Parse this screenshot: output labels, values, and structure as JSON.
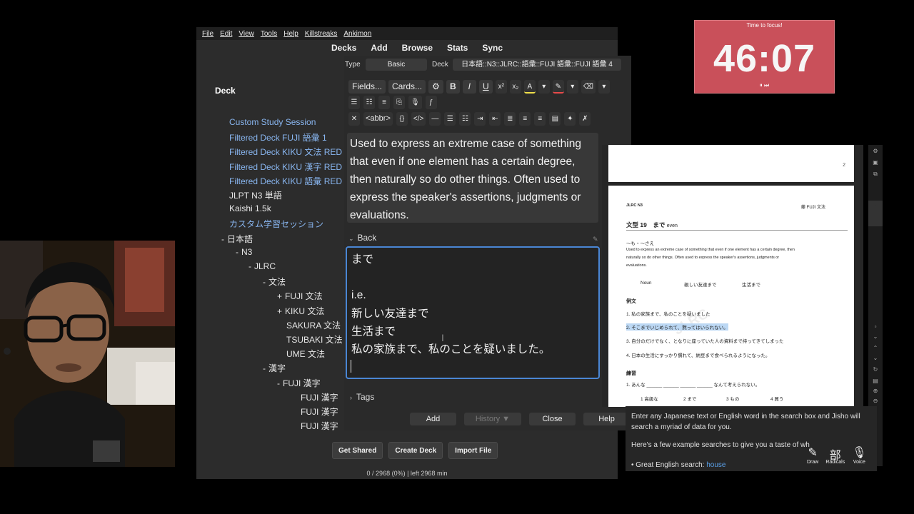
{
  "menubar": {
    "items": [
      "File",
      "Edit",
      "View",
      "Tools",
      "Help",
      "Killstreaks",
      "Ankimon"
    ]
  },
  "toolbar": {
    "items": [
      "Decks",
      "Add",
      "Browse",
      "Stats",
      "Sync"
    ]
  },
  "deck_header": "Deck",
  "decks": [
    {
      "label": "Custom Study Session",
      "style": "blue",
      "prefix": "",
      "indent": 0
    },
    {
      "label": "Filtered Deck FUJI 語彙 1",
      "style": "blue",
      "prefix": "",
      "indent": 0
    },
    {
      "label": "Filtered Deck KIKU 文法 RED",
      "style": "blue",
      "prefix": "",
      "indent": 0
    },
    {
      "label": "Filtered Deck KIKU 漢字 RED",
      "style": "blue",
      "prefix": "",
      "indent": 0
    },
    {
      "label": "Filtered Deck KIKU 語彙 RED",
      "style": "blue",
      "prefix": "",
      "indent": 0
    },
    {
      "label": "JLPT N3 単語",
      "style": "white",
      "prefix": "",
      "indent": 0
    },
    {
      "label": "Kaishi 1.5k",
      "style": "white",
      "prefix": "",
      "indent": 0
    },
    {
      "label": "カスタム学習セッション",
      "style": "blue",
      "prefix": "",
      "indent": 0
    },
    {
      "label": "日本語",
      "style": "white",
      "prefix": "-",
      "indent": 1
    },
    {
      "label": "N3",
      "style": "white",
      "prefix": "-",
      "indent": 2
    },
    {
      "label": "JLRC",
      "style": "white",
      "prefix": "-",
      "indent": 3
    },
    {
      "label": "文法",
      "style": "white",
      "prefix": "-",
      "indent": 4
    },
    {
      "label": "FUJI 文法",
      "style": "white",
      "prefix": "+",
      "indent": 5
    },
    {
      "label": "KIKU 文法",
      "style": "white",
      "prefix": "+",
      "indent": 5
    },
    {
      "label": "SAKURA 文法",
      "style": "white",
      "prefix": "",
      "indent": 6
    },
    {
      "label": "TSUBAKI 文法",
      "style": "white",
      "prefix": "",
      "indent": 6
    },
    {
      "label": "UME 文法",
      "style": "white",
      "prefix": "",
      "indent": 6
    },
    {
      "label": "漢字",
      "style": "white",
      "prefix": "-",
      "indent": 4
    },
    {
      "label": "FUJI 漢字",
      "style": "white",
      "prefix": "-",
      "indent": 5
    },
    {
      "label": "FUJI 漢字",
      "style": "white",
      "prefix": "",
      "indent": 7
    },
    {
      "label": "FUJI 漢字",
      "style": "white",
      "prefix": "",
      "indent": 7
    },
    {
      "label": "FUJI 漢字",
      "style": "white",
      "prefix": "",
      "indent": 7
    }
  ],
  "bottom_buttons": [
    "Get Shared",
    "Create Deck",
    "Import File"
  ],
  "status_line": "0 / 2968 (0%) | left 2968 min",
  "editor": {
    "type_label": "Type",
    "type_value": "Basic",
    "deck_label": "Deck",
    "deck_value": "日本語::N3::JLRC::語彙::FUJI 語彙::FUJI 語彙 4",
    "fields_button": "Fields...",
    "cards_button": "Cards...",
    "abbr_button": "<abbr>",
    "front_text": "Used to express an extreme case of something that even if one element has a certain degree, then naturally so do other things. Often used to express the speaker's assertions, judgments or evaluations.",
    "back_label": "Back",
    "back_lines": [
      "まで",
      "",
      "i.e.",
      "新しい友達まで",
      "生活まで",
      "私の家族まで、私のことを疑いました。"
    ],
    "tags_label": "Tags",
    "buttons": {
      "add": "Add",
      "history": "History ▼",
      "close": "Close",
      "help": "Help"
    }
  },
  "timer": {
    "label": "Time to focus!",
    "time": "46:07",
    "controls": "⏸ ⏭"
  },
  "pdf": {
    "page_number": "2",
    "header_left": "JLRC N3",
    "header_right": "藤 FUJI 文法",
    "title": "文型 19　まで",
    "title_en": "even",
    "pattern": "〜も・〜さえ",
    "desc1": "Used to express an extreme case of something that even if one element has a certain degree, then",
    "desc2": "naturally so do other things. Often used to express the speaker's assertions, judgments or",
    "desc3": "evaluations.",
    "table": [
      "Noun",
      "親しい友達まで",
      "生活まで"
    ],
    "examples_heading": "例文",
    "examples": [
      "1. 私の家族まで、私のことを疑いました",
      "2. そこまでいじめられて、黙ってはいられない。",
      "3. 自分のだけでなく、となりに座っていた人の資料まで持ってきてしまった",
      "4. 日本の生活にすっかり慣れて、納豆まで食べられるようになった。"
    ],
    "practice_heading": "練習",
    "practice": "1. あんな ______ ______ ______ ______ なんて考えられない。",
    "options": [
      "1 高級な",
      "2 まで",
      "3 もの",
      "4 買う"
    ],
    "watermark": "JLRC"
  },
  "jisho": {
    "intro": "Enter any Japanese text or English word in the search box and Jisho will search a myriad of data for you.",
    "examples_text": "Here's a few example searches to give you a taste of wh",
    "bullet_label": "Great English search:",
    "bullet_link": "house",
    "tools": [
      {
        "glyph": "✎",
        "label": "Draw"
      },
      {
        "glyph": "部",
        "label": "Radicals"
      },
      {
        "glyph": "🎙",
        "label": "Voice"
      }
    ]
  },
  "colors": {
    "accent_blue": "#4a86d4",
    "deck_blue": "#89b6f0",
    "timer_red": "#c9505a"
  }
}
